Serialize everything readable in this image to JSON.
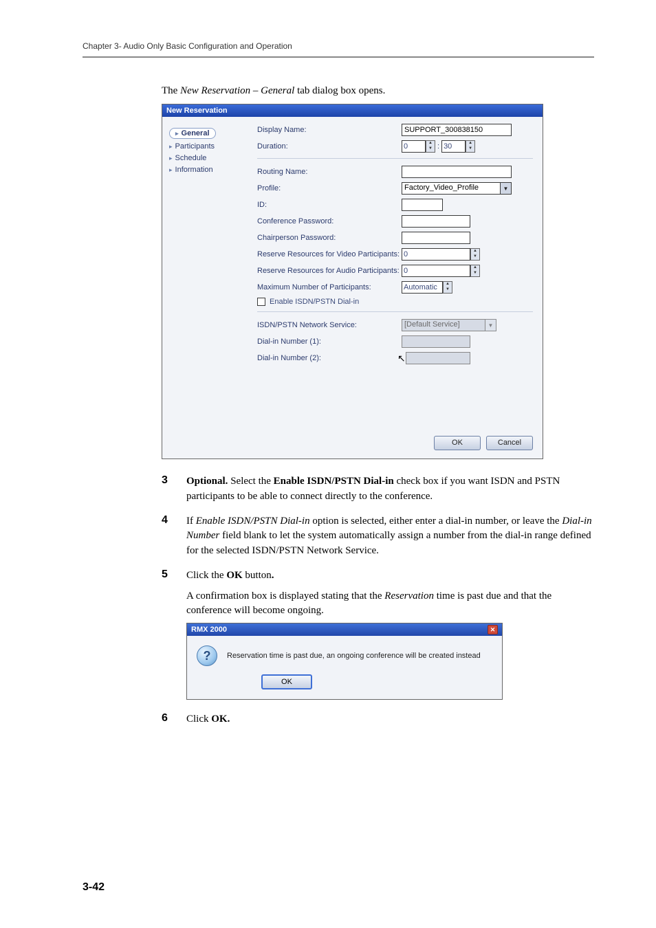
{
  "header": {
    "chapter": "Chapter 3- Audio Only Basic Configuration and Operation"
  },
  "caption": {
    "prefix": "The ",
    "em1": "New Reservation",
    "mid": " – ",
    "em2": "General",
    "suffix": " tab dialog box opens."
  },
  "dialog": {
    "title": "New Reservation",
    "nav": {
      "general": "General",
      "participants": "Participants",
      "schedule": "Schedule",
      "information": "Information"
    },
    "labels": {
      "displayName": "Display Name:",
      "duration": "Duration:",
      "routingName": "Routing Name:",
      "profile": "Profile:",
      "id": "ID:",
      "confPass": "Conference Password:",
      "chairPass": "Chairperson Password:",
      "resVideo": "Reserve Resources for Video Participants:",
      "resAudio": "Reserve Resources for Audio Participants:",
      "maxPart": "Maximum Number of Participants:",
      "enableIsdn": "Enable ISDN/PSTN Dial-in",
      "isdnService": "ISDN/PSTN Network Service:",
      "dial1": "Dial-in Number (1):",
      "dial2": "Dial-in Number (2):"
    },
    "values": {
      "displayName": "SUPPORT_300838150",
      "durationH": "0",
      "durationM": "30",
      "profile": "Factory_Video_Profile",
      "resVideo": "0",
      "resAudio": "0",
      "maxPart": "Automatic",
      "isdnService": "[Default Service]"
    },
    "footer": {
      "ok": "OK",
      "cancel": "Cancel"
    }
  },
  "steps": {
    "n3": "3",
    "s3_optional": "Optional.",
    "s3_a": " Select the ",
    "s3_b": "Enable ISDN/PSTN Dial-in",
    "s3_c": " check box if you want ISDN and PSTN participants to be able to connect directly to the conference.",
    "n4": "4",
    "s4_a": "If ",
    "s4_em1": "Enable ISDN/PSTN Dial-in",
    "s4_b": " option is selected, either enter a dial-in number, or leave the ",
    "s4_em2": "Dial-in Number",
    "s4_c": " field blank to let the system automatically assign a number from the dial-in range defined for the selected ISDN/PSTN Network Service.",
    "n5": "5",
    "s5_a": "Click the ",
    "s5_b": "OK",
    "s5_c": " button",
    "s5_d": ".",
    "s5_e": "A confirmation box is displayed stating that the ",
    "s5_em": "Reservation",
    "s5_f": " time is past due and that the conference will become ongoing.",
    "n6": "6",
    "s6_a": "Click ",
    "s6_b": "OK."
  },
  "msgbox": {
    "title": "RMX 2000",
    "text": "Reservation time is past due, an ongoing conference will be created instead",
    "icon": "?",
    "ok": "OK"
  },
  "pageNumber": "3-42"
}
